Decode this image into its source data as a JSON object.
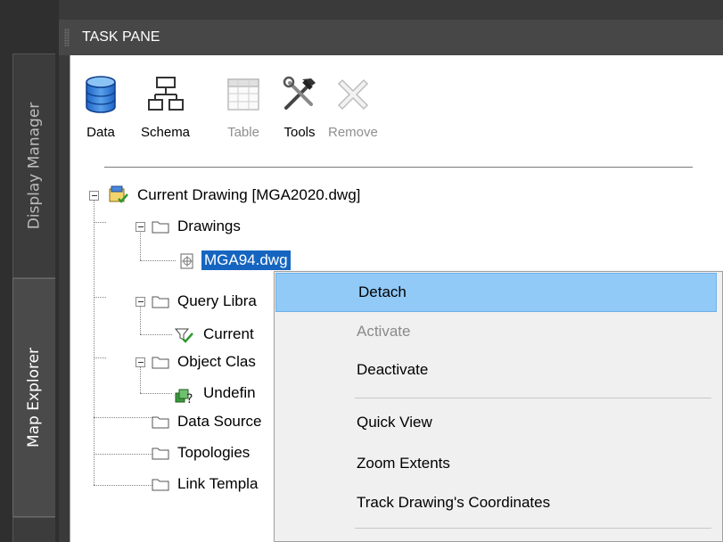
{
  "side_tabs": {
    "display_manager": "Display Manager",
    "map_explorer": "Map Explorer"
  },
  "titlebar": {
    "title": "TASK PANE"
  },
  "toolbar": {
    "data": "Data",
    "schema": "Schema",
    "table": "Table",
    "tools": "Tools",
    "remove": "Remove"
  },
  "tree": {
    "root": "Current Drawing [MGA2020.dwg]",
    "drawings": "Drawings",
    "mga94": "MGA94.dwg",
    "query_library": "Query Libra",
    "current_query": "Current",
    "object_classes": "Object Clas",
    "undefined": "Undefin",
    "data_sources": "Data Source",
    "topologies": "Topologies",
    "link_templates": "Link Templa"
  },
  "context_menu": {
    "detach": "Detach",
    "activate": "Activate",
    "deactivate": "Deactivate",
    "quick_view": "Quick View",
    "zoom_extents": "Zoom Extents",
    "track_coords": "Track Drawing's Coordinates"
  },
  "colors": {
    "selection": "#1565c0",
    "menu_highlight": "#91c9f7",
    "dark_chrome": "#474747"
  }
}
